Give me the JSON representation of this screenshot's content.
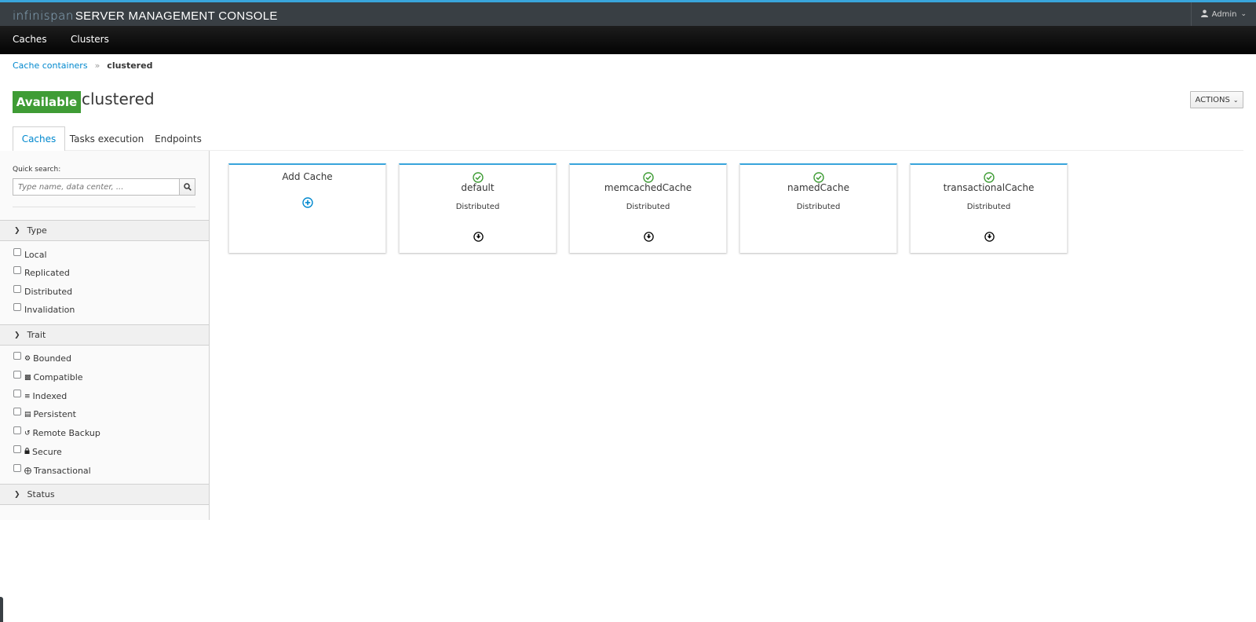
{
  "header": {
    "logo_text": "infinispan",
    "title": "SERVER MANAGEMENT CONSOLE",
    "user": "Admin"
  },
  "nav": {
    "items": [
      {
        "label": "Caches"
      },
      {
        "label": "Clusters"
      }
    ]
  },
  "breadcrumb": {
    "parent": "Cache containers",
    "separator": "»",
    "current": "clustered"
  },
  "page": {
    "status": "Available",
    "status_color": "#3f9c35",
    "title": "clustered",
    "actions_label": "ACTIONS"
  },
  "tabs": [
    {
      "label": "Caches",
      "active": true
    },
    {
      "label": "Tasks execution",
      "active": false
    },
    {
      "label": "Endpoints",
      "active": false
    }
  ],
  "sidebar": {
    "quick_search_label": "Quick search:",
    "quick_search_placeholder": "Type name, data center, ...",
    "sections": [
      {
        "label": "Type",
        "items": [
          {
            "label": "Local",
            "icon": ""
          },
          {
            "label": "Replicated",
            "icon": ""
          },
          {
            "label": "Distributed",
            "icon": ""
          },
          {
            "label": "Invalidation",
            "icon": ""
          }
        ]
      },
      {
        "label": "Trait",
        "items": [
          {
            "label": "Bounded",
            "icon": "bounded-icon"
          },
          {
            "label": "Compatible",
            "icon": "puzzle-icon"
          },
          {
            "label": "Indexed",
            "icon": "list-icon"
          },
          {
            "label": "Persistent",
            "icon": "database-icon"
          },
          {
            "label": "Remote Backup",
            "icon": "history-icon"
          },
          {
            "label": "Secure",
            "icon": "lock-icon"
          },
          {
            "label": "Transactional",
            "icon": "transaction-icon"
          }
        ]
      },
      {
        "label": "Status",
        "items": []
      }
    ]
  },
  "cards": {
    "add_label": "Add Cache",
    "caches": [
      {
        "name": "default",
        "mode": "Distributed",
        "status": "ok",
        "has_action": true
      },
      {
        "name": "memcachedCache",
        "mode": "Distributed",
        "status": "ok",
        "has_action": true
      },
      {
        "name": "namedCache",
        "mode": "Distributed",
        "status": "ok",
        "has_action": false
      },
      {
        "name": "transactionalCache",
        "mode": "Distributed",
        "status": "ok",
        "has_action": true
      }
    ]
  },
  "colors": {
    "accent": "#0088ce",
    "card_border": "#39a5dc",
    "ok_green": "#3f9c35"
  }
}
